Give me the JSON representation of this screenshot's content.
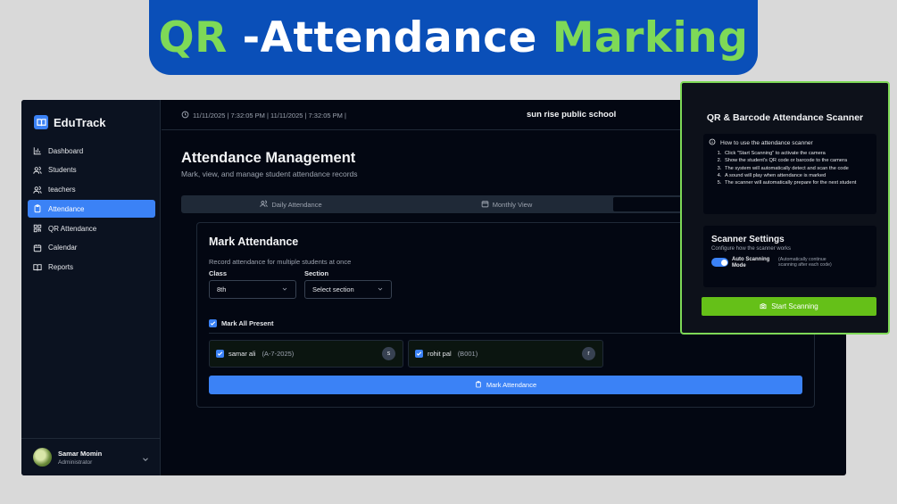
{
  "banner": {
    "part1": "QR",
    "part2": " -Attendance ",
    "part3": "Marking"
  },
  "app": {
    "brand": "EduTrack",
    "nav": [
      {
        "label": "Dashboard",
        "icon": "bar-chart-icon",
        "active": false
      },
      {
        "label": "Students",
        "icon": "users-icon",
        "active": false
      },
      {
        "label": "teachers",
        "icon": "users-icon",
        "active": false
      },
      {
        "label": "Attendance",
        "icon": "clipboard-icon",
        "active": true
      },
      {
        "label": "QR Attendance",
        "icon": "qr-icon",
        "active": false
      },
      {
        "label": "Calendar",
        "icon": "calendar-icon",
        "active": false
      },
      {
        "label": "Reports",
        "icon": "book-icon",
        "active": false
      }
    ],
    "user": {
      "name": "Samar Momin",
      "role": "Administrator"
    },
    "header": {
      "datetime": "11/11/2025 | 7:32:05 PM | 11/11/2025 | 7:32:05 PM |",
      "school": "sun rise public school"
    },
    "page": {
      "title": "Attendance Management",
      "subtitle": "Mark, view, and manage student attendance records"
    },
    "tabs": [
      {
        "label": "Daily Attendance"
      },
      {
        "label": "Monthly View"
      },
      {
        "label": ""
      }
    ],
    "mark": {
      "title": "Mark Attendance",
      "subtitle": "Record attendance for multiple students at once",
      "class_label": "Class",
      "class_value": "8th",
      "section_label": "Section",
      "section_value": "Select section",
      "mark_all": "Mark All Present",
      "students": [
        {
          "name": "samar ali",
          "id": "(A-7-2025)",
          "initial": "s"
        },
        {
          "name": "rohit pal",
          "id": "(B001)",
          "initial": "r"
        }
      ],
      "submit": "Mark Attendance"
    }
  },
  "scanner": {
    "title": "QR & Barcode Attendance Scanner",
    "howto_title": "How to use the attendance scanner",
    "steps": [
      "Click \"Start Scanning\" to activate the camera",
      "Show the student's QR code or barcode to the camera",
      "The system will automatically detect and scan the code",
      "A sound will play when attendance is marked",
      "The scanner will automatically prepare for the next student"
    ],
    "settings_title": "Scanner Settings",
    "settings_sub": "Configure how the scanner works",
    "toggle_label": "Auto Scanning Mode",
    "toggle_note": "(Automatically continue scanning after each code)",
    "start_button": "Start Scanning"
  },
  "colors": {
    "banner_bg": "#0a4fb8",
    "banner_green": "#7ed957",
    "accent_blue": "#3b82f6",
    "start_green": "#65c018",
    "app_bg": "#030712"
  }
}
